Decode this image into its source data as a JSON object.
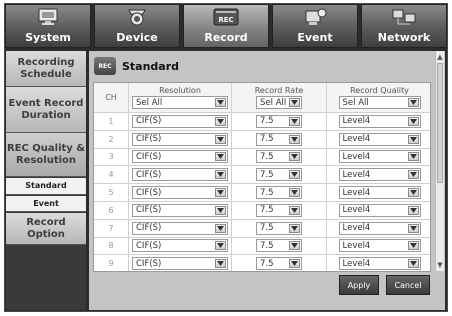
{
  "tabs": [
    {
      "label": "System",
      "icon": "monitor-icon",
      "active": false
    },
    {
      "label": "Device",
      "icon": "camera-icon",
      "active": false
    },
    {
      "label": "Record",
      "icon": "rec-icon",
      "active": true,
      "icon_text": "REC"
    },
    {
      "label": "Event",
      "icon": "event-icon",
      "active": false
    },
    {
      "label": "Network",
      "icon": "network-icon",
      "active": false
    }
  ],
  "menu": {
    "recording_schedule": "Recording Schedule",
    "event_record_duration": "Event Record Duration",
    "rec_quality_resolution": "REC Quality & Resolution",
    "standard": "Standard",
    "event": "Event",
    "record_option": "Record Option"
  },
  "panel": {
    "title": "Standard",
    "icon_text": "REC"
  },
  "table": {
    "headers": {
      "ch": "CH",
      "resolution": "Resolution",
      "record_rate": "Record Rate",
      "record_quality": "Record Quality"
    },
    "select_all": {
      "resolution": "Sel All",
      "record_rate": "Sel All",
      "record_quality": "Sel All"
    },
    "rows": [
      {
        "ch": "1",
        "resolution": "CIF(S)",
        "rate": "7.5",
        "quality": "Level4"
      },
      {
        "ch": "2",
        "resolution": "CIF(S)",
        "rate": "7.5",
        "quality": "Level4"
      },
      {
        "ch": "3",
        "resolution": "CIF(S)",
        "rate": "7.5",
        "quality": "Level4"
      },
      {
        "ch": "4",
        "resolution": "CIF(S)",
        "rate": "7.5",
        "quality": "Level4"
      },
      {
        "ch": "5",
        "resolution": "CIF(S)",
        "rate": "7.5",
        "quality": "Level4"
      },
      {
        "ch": "6",
        "resolution": "CIF(S)",
        "rate": "7.5",
        "quality": "Level4"
      },
      {
        "ch": "7",
        "resolution": "CIF(S)",
        "rate": "7.5",
        "quality": "Level4"
      },
      {
        "ch": "8",
        "resolution": "CIF(S)",
        "rate": "7.5",
        "quality": "Level4"
      },
      {
        "ch": "9",
        "resolution": "CIF(S)",
        "rate": "7.5",
        "quality": "Level4"
      }
    ]
  },
  "buttons": {
    "apply": "Apply",
    "cancel": "Cancel"
  }
}
